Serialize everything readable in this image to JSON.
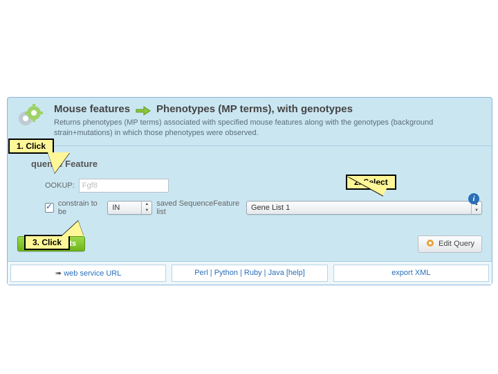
{
  "header": {
    "title_left": "Mouse features",
    "title_right": "Phenotypes (MP terms), with genotypes",
    "description": "Returns phenotypes (MP terms) associated with specified mouse features along with the genotypes (background strain+mutations) in which those phenotypes were observed."
  },
  "section": {
    "title": "quence Feature",
    "lookup_label": "OOKUP:",
    "lookup_value": "Fgf8",
    "constrain_label": "constrain to be",
    "in_value": "IN",
    "saved_list_label": "saved SequenceFeature list",
    "list_value": "Gene List 1"
  },
  "actions": {
    "show_results": "Show Results",
    "edit_query": "Edit Query"
  },
  "footer": {
    "web_service": "web service URL",
    "langs": "Perl | Python | Ruby | Java [help]",
    "export_xml": "export XML"
  },
  "callouts": {
    "c1": "1. Click",
    "c2": "2. Select",
    "c3": "3. Click"
  },
  "icons": {
    "info": "i"
  }
}
